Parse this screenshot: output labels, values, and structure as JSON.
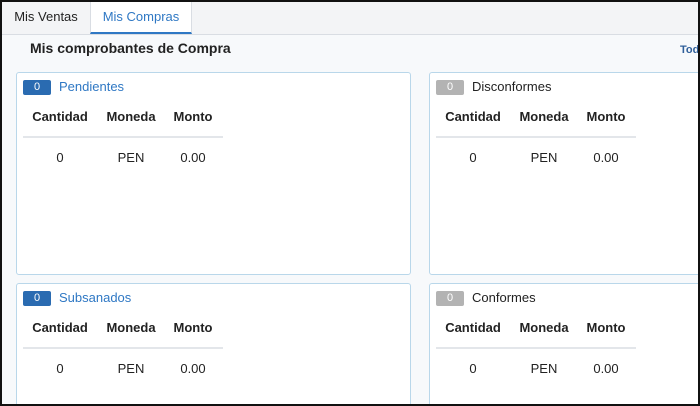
{
  "tabs": [
    {
      "label": "Mis Ventas",
      "active": false
    },
    {
      "label": "Mis Compras",
      "active": true
    }
  ],
  "page_title": "Mis comprobantes de Compra",
  "todos_link": "Tod",
  "table_headers": [
    "Cantidad",
    "Moneda",
    "Monto"
  ],
  "cards": [
    {
      "badge": "0",
      "badge_color": "#2a6bb1",
      "title": "Pendientes",
      "rows": [
        {
          "cantidad": "0",
          "moneda": "PEN",
          "monto": "0.00"
        }
      ]
    },
    {
      "badge": "0",
      "badge_color": "#b3b3b3",
      "title": "Disconformes",
      "rows": [
        {
          "cantidad": "0",
          "moneda": "PEN",
          "monto": "0.00"
        }
      ]
    },
    {
      "badge": "0",
      "badge_color": "#2a6bb1",
      "title": "Subsanados",
      "rows": [
        {
          "cantidad": "0",
          "moneda": "PEN",
          "monto": "0.00"
        }
      ]
    },
    {
      "badge": "0",
      "badge_color": "#b3b3b3",
      "title": "Conformes",
      "rows": [
        {
          "cantidad": "0",
          "moneda": "PEN",
          "monto": "0.00"
        }
      ]
    }
  ],
  "colors": {
    "accent": "#2f78c4",
    "badge_blue": "#2a6bb1",
    "badge_gray": "#b3b3b3",
    "card_border": "#b9d7ea"
  }
}
